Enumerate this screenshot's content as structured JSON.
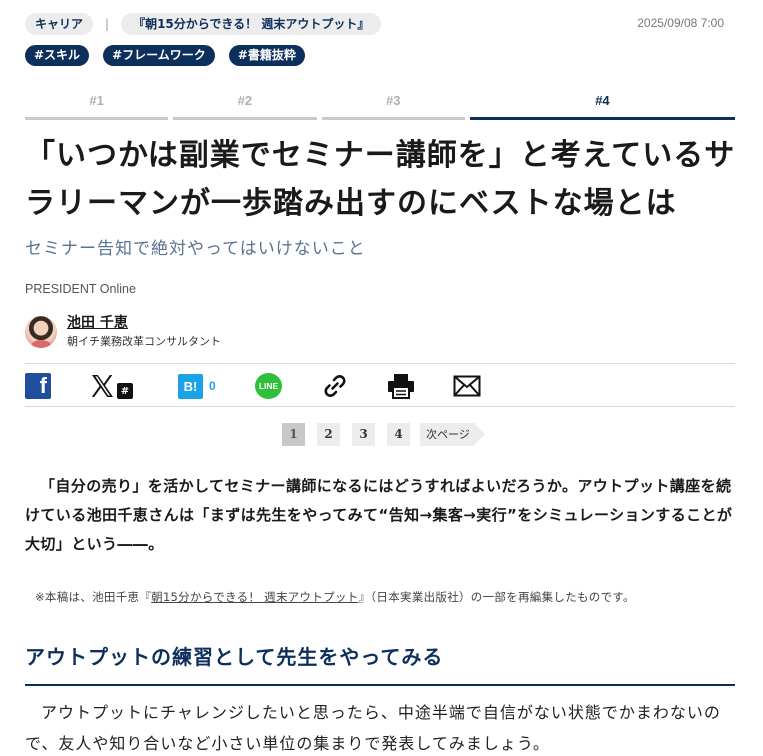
{
  "header": {
    "category": "キャリア",
    "separator": "|",
    "series": "『朝15分からできる！ 週末アウトプット』",
    "date": "2025/09/08 7:00",
    "tags": [
      "#スキル",
      "#フレームワーク",
      "#書籍抜粋"
    ]
  },
  "tabs": [
    {
      "label": "#1"
    },
    {
      "label": "#2"
    },
    {
      "label": "#3"
    },
    {
      "label": "#4"
    }
  ],
  "article": {
    "title": "「いつかは副業でセミナー講師を」と考えているサラリーマンが一歩踏み出すのにベストな場とは",
    "subtitle": "セミナー告知で絶対やってはいけないこと",
    "publisher": "PRESIDENT Online",
    "author_name": "池田 千恵",
    "author_role": "朝イチ業務改革コンサルタント"
  },
  "share": {
    "facebook_icon": "facebook-icon",
    "x_icon": "x-icon",
    "x_badge": "#",
    "hatena_label": "B!",
    "hatena_count": "0",
    "line_label": "LINE",
    "link_icon": "link-icon",
    "print_icon": "print-icon",
    "mail_icon": "mail-icon"
  },
  "pager": {
    "pages": [
      "1",
      "2",
      "3",
      "4"
    ],
    "current": "1",
    "next_label": "次ページ"
  },
  "lead": "「自分の売り」を活かしてセミナー講師になるにはどうすればよいだろうか。アウトプット講座を続けている池田千恵さんは「まずは先生をやってみて“告知→集客→実行”をシミュレーションすることが大切」という――。",
  "note": {
    "prefix": "※本稿は、池田千恵『",
    "link": "朝15分からできる！ 週末アウトプット",
    "suffix": "』（日本実業出版社）の一部を再編集したものです。"
  },
  "section": {
    "heading": "アウトプットの練習として先生をやってみる",
    "paragraph": "アウトプットにチャレンジしたいと思ったら、中途半端で自信がない状態でかまわないので、友人や知り合いなど小さい単位の集まりで発表してみましょう。"
  },
  "colors": {
    "navy": "#0d2f5c",
    "facebook": "#1f4e9c",
    "hatena": "#1ba2e6",
    "line": "#2fbf3a"
  }
}
